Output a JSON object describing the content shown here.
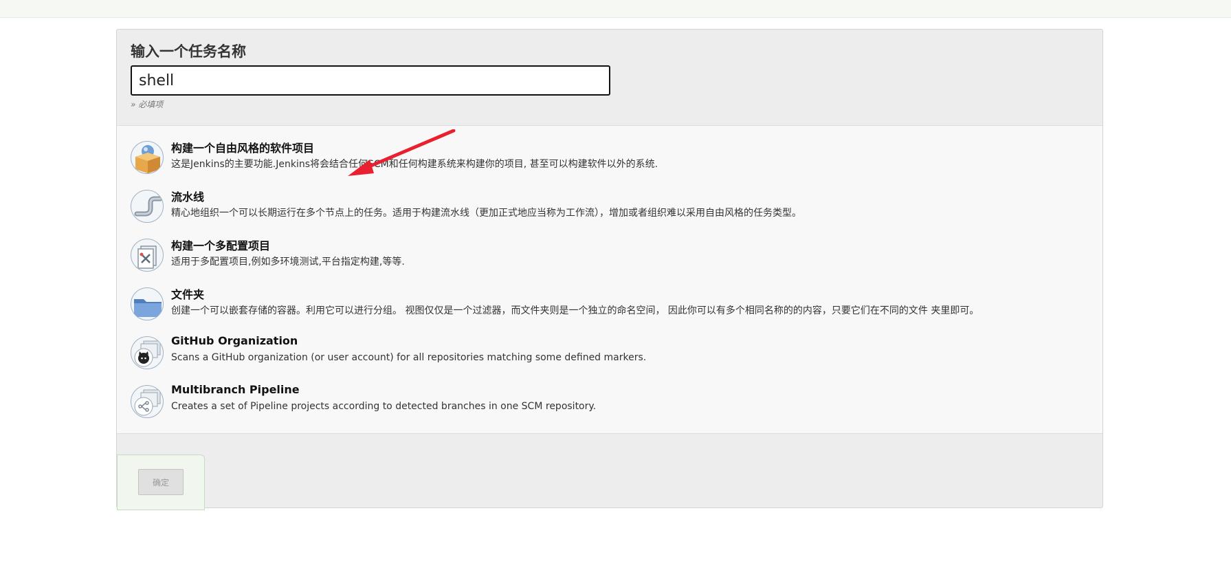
{
  "name_section": {
    "label": "输入一个任务名称",
    "input_value": "shell",
    "required_note": "» 必填项"
  },
  "items": [
    {
      "title": "构建一个自由风格的软件项目",
      "description": "这是Jenkins的主要功能.Jenkins将会结合任何SCM和任何构建系统来构建你的项目, 甚至可以构建软件以外的系统.",
      "icon": "freestyle-package-icon"
    },
    {
      "title": "流水线",
      "description": "精心地组织一个可以长期运行在多个节点上的任务。适用于构建流水线（更加正式地应当称为工作流），增加或者组织难以采用自由风格的任务类型。",
      "icon": "pipeline-icon"
    },
    {
      "title": "构建一个多配置项目",
      "description": "适用于多配置项目,例如多环境测试,平台指定构建,等等.",
      "icon": "multi-config-icon"
    },
    {
      "title": "文件夹",
      "description": "创建一个可以嵌套存储的容器。利用它可以进行分组。 视图仅仅是一个过滤器，而文件夹则是一个独立的命名空间， 因此你可以有多个相同名称的的内容，只要它们在不同的文件 夹里即可。",
      "icon": "folder-icon"
    },
    {
      "title": "GitHub Organization",
      "description": "Scans a GitHub organization (or user account) for all repositories matching some defined markers.",
      "icon": "github-organization-icon"
    },
    {
      "title": "Multibranch Pipeline",
      "description": "Creates a set of Pipeline projects according to detected branches in one SCM repository.",
      "icon": "multibranch-pipeline-icon"
    }
  ],
  "footer": {
    "ok_label": "确定"
  },
  "colors": {
    "annotation_arrow": "#e8202f",
    "panel_background": "#ededed",
    "list_background": "#f8f8f8"
  }
}
